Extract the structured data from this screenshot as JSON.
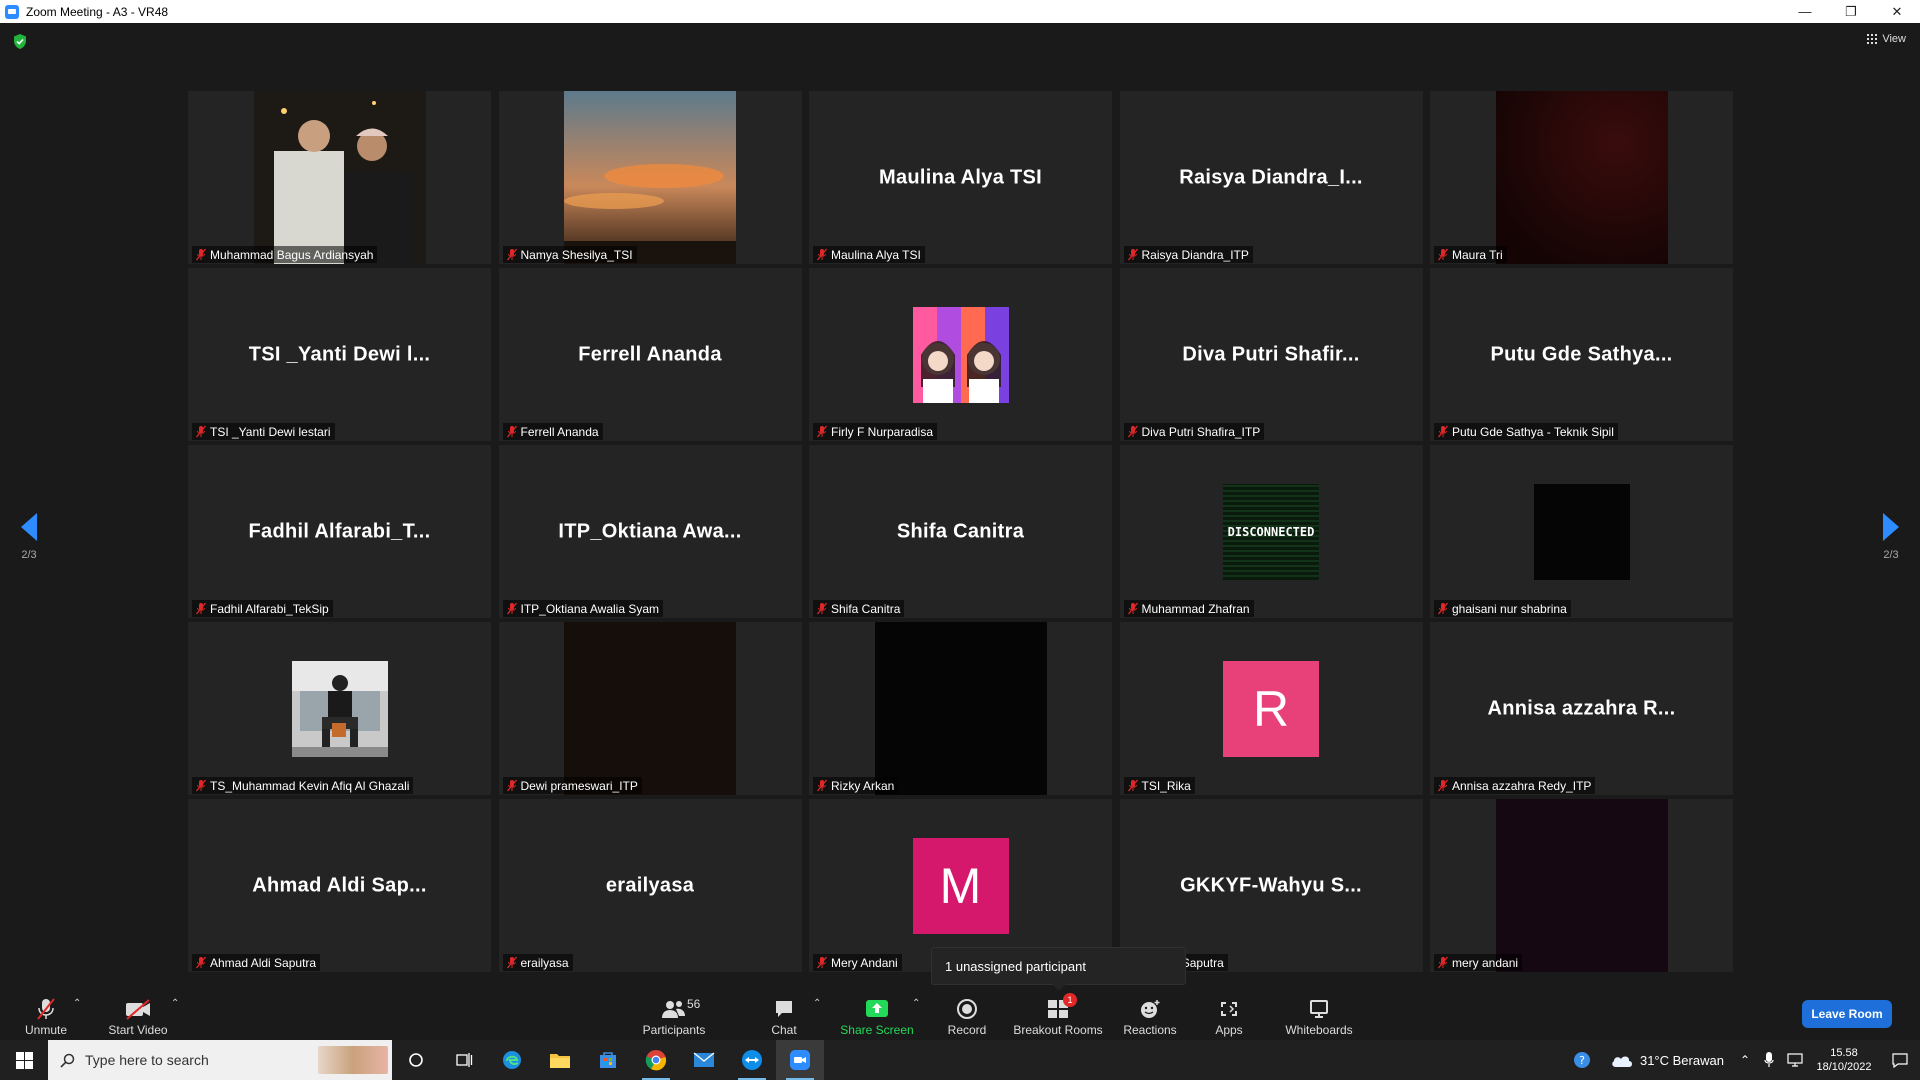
{
  "window": {
    "title": "Zoom Meeting - A3 - VR48",
    "controls": {
      "minimize": "—",
      "restore": "❐",
      "close": "✕"
    }
  },
  "top": {
    "view_label": "View"
  },
  "pagination": {
    "left": "2/3",
    "right": "2/3"
  },
  "tiles": [
    {
      "label": "Muhammad Bagus Ardiansyah",
      "kind": "photo",
      "photo": "friends"
    },
    {
      "label": "Namya Shesilya_TSI",
      "kind": "photo",
      "photo": "sunset"
    },
    {
      "label": "Maulina Alya TSI",
      "kind": "name",
      "bigname": "Maulina Alya TSI"
    },
    {
      "label": "Raisya Diandra_ITP",
      "kind": "name",
      "bigname": "Raisya  Diandra_I..."
    },
    {
      "label": "Maura Tri",
      "kind": "photo",
      "photo": "darkred"
    },
    {
      "label": "TSI _Yanti Dewi lestari",
      "kind": "name",
      "bigname": "TSI _Yanti Dewi l..."
    },
    {
      "label": "Ferrell Ananda",
      "kind": "name",
      "bigname": "Ferrell Ananda"
    },
    {
      "label": "Firly F Nurparadisa",
      "kind": "avatar",
      "photo": "colorful"
    },
    {
      "label": "Diva Putri Shafira_ITP",
      "kind": "name",
      "bigname": "Diva  Putri  Shafir..."
    },
    {
      "label": "Putu Gde Sathya - Teknik Sipil",
      "kind": "name",
      "bigname": "Putu Gde Sathya..."
    },
    {
      "label": "Fadhil Alfarabi_TekSip",
      "kind": "name",
      "bigname": "Fadhil  Alfarabi_T..."
    },
    {
      "label": "ITP_Oktiana Awalia Syam",
      "kind": "name",
      "bigname": "ITP_Oktiana  Awa..."
    },
    {
      "label": "Shifa Canitra",
      "kind": "name",
      "bigname": "Shifa Canitra"
    },
    {
      "label": "Muhammad Zhafran",
      "kind": "avatar",
      "photo": "disconnected",
      "avatar_text": "DISCONNECTED"
    },
    {
      "label": "ghaisani nur shabrina",
      "kind": "avatar",
      "photo": "black"
    },
    {
      "label": "TS_Muhammad Kevin Afiq Al Ghazali",
      "kind": "avatar",
      "photo": "person"
    },
    {
      "label": "Dewi prameswari_ITP",
      "kind": "photo",
      "photo": "darkbrown"
    },
    {
      "label": "Rizky Arkan",
      "kind": "photo",
      "photo": "black"
    },
    {
      "label": "TSI_Rika",
      "kind": "letter",
      "letter": "R",
      "color": "#e8417a"
    },
    {
      "label": "Annisa azzahra Redy_ITP",
      "kind": "name",
      "bigname": "Annisa azzahra R..."
    },
    {
      "label": "Ahmad Aldi Saputra",
      "kind": "name",
      "bigname": "Ahmad  Aldi  Sap..."
    },
    {
      "label": "erailyasa",
      "kind": "name",
      "bigname": "erailyasa"
    },
    {
      "label": "Mery Andani",
      "kind": "letter",
      "letter": "M",
      "color": "#d6186c"
    },
    {
      "label": "Wahyu Saputra",
      "kind": "name",
      "bigname": "GKKYF-Wahyu  S..."
    },
    {
      "label": "mery andani",
      "kind": "photo",
      "photo": "darkpurple"
    }
  ],
  "tooltip": "1 unassigned participant",
  "toolbar": {
    "unmute": "Unmute",
    "start_video": "Start Video",
    "participants": "Participants",
    "participants_count": "56",
    "chat": "Chat",
    "share_screen": "Share Screen",
    "record": "Record",
    "breakout_rooms": "Breakout Rooms",
    "breakout_badge": "1",
    "reactions": "Reactions",
    "apps": "Apps",
    "whiteboards": "Whiteboards",
    "leave": "Leave Room"
  },
  "taskbar": {
    "search_placeholder": "Type here to search",
    "weather": "31°C  Berawan",
    "time": "15.58",
    "date": "18/10/2022"
  },
  "colors": {
    "accent": "#2d8cff",
    "share_green": "#23d959",
    "muted_red": "#e02828"
  }
}
